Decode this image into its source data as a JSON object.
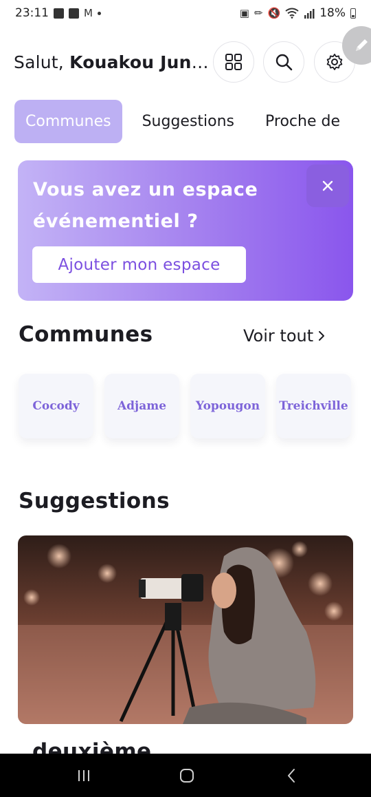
{
  "status_bar": {
    "time": "23:11",
    "battery_text": "18%",
    "left_icons": [
      "gallery-icon",
      "checkbox-icon",
      "gmail-icon",
      "notification-dot"
    ],
    "right_icons": [
      "lock-icon",
      "pen-icon",
      "mute-icon",
      "wifi-icon",
      "signal-icon",
      "battery-icon"
    ]
  },
  "header": {
    "greeting_prefix": "Salut,",
    "user_name": "Kouakou Juni...",
    "buttons": [
      "grid-icon",
      "search-icon",
      "settings-icon"
    ]
  },
  "tabs": [
    {
      "label": "Communes",
      "active": true
    },
    {
      "label": "Suggestions",
      "active": false
    },
    {
      "label": "Proche de",
      "active": false
    }
  ],
  "promo": {
    "title": "Vous avez un espace événementiel ?",
    "button_label": "Ajouter mon espace",
    "close_icon": "close-icon"
  },
  "communes_section": {
    "title": "Communes",
    "see_all_label": "Voir tout",
    "items": [
      "Cocody",
      "Adjame",
      "Yopougon",
      "Treichville"
    ]
  },
  "suggestions_section": {
    "title": "Suggestions",
    "next_item_title": "deuxième"
  },
  "colors": {
    "accent": "#8a56ed",
    "accent_light": "#bdb0f3",
    "commune_text": "#7d64d9"
  }
}
